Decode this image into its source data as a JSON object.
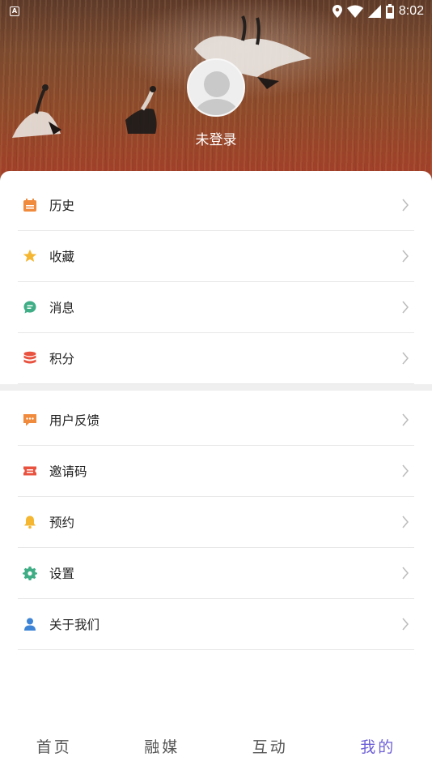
{
  "status_bar": {
    "left_icon": "A",
    "time": "8:02"
  },
  "profile": {
    "login_status": "未登录"
  },
  "menu": {
    "group1": [
      {
        "label": "历史",
        "icon": "calendar-icon",
        "color": "#f08a3c"
      },
      {
        "label": "收藏",
        "icon": "star-icon",
        "color": "#f5b731"
      },
      {
        "label": "消息",
        "icon": "chat-bubble-icon",
        "color": "#3fae86"
      },
      {
        "label": "积分",
        "icon": "coin-stack-icon",
        "color": "#e8523f"
      }
    ],
    "group2": [
      {
        "label": "用户反馈",
        "icon": "feedback-icon",
        "color": "#f08a3c"
      },
      {
        "label": "邀请码",
        "icon": "ticket-icon",
        "color": "#e8523f"
      },
      {
        "label": "预约",
        "icon": "bell-icon",
        "color": "#f5b731"
      },
      {
        "label": "设置",
        "icon": "gear-icon",
        "color": "#3fae86"
      },
      {
        "label": "关于我们",
        "icon": "person-icon",
        "color": "#3d84d6"
      }
    ]
  },
  "bottom_nav": {
    "items": [
      {
        "label": "首页"
      },
      {
        "label": "融媒"
      },
      {
        "label": "互动"
      },
      {
        "label": "我的"
      }
    ],
    "active_index": 3,
    "active_color": "#6d5fd6"
  }
}
